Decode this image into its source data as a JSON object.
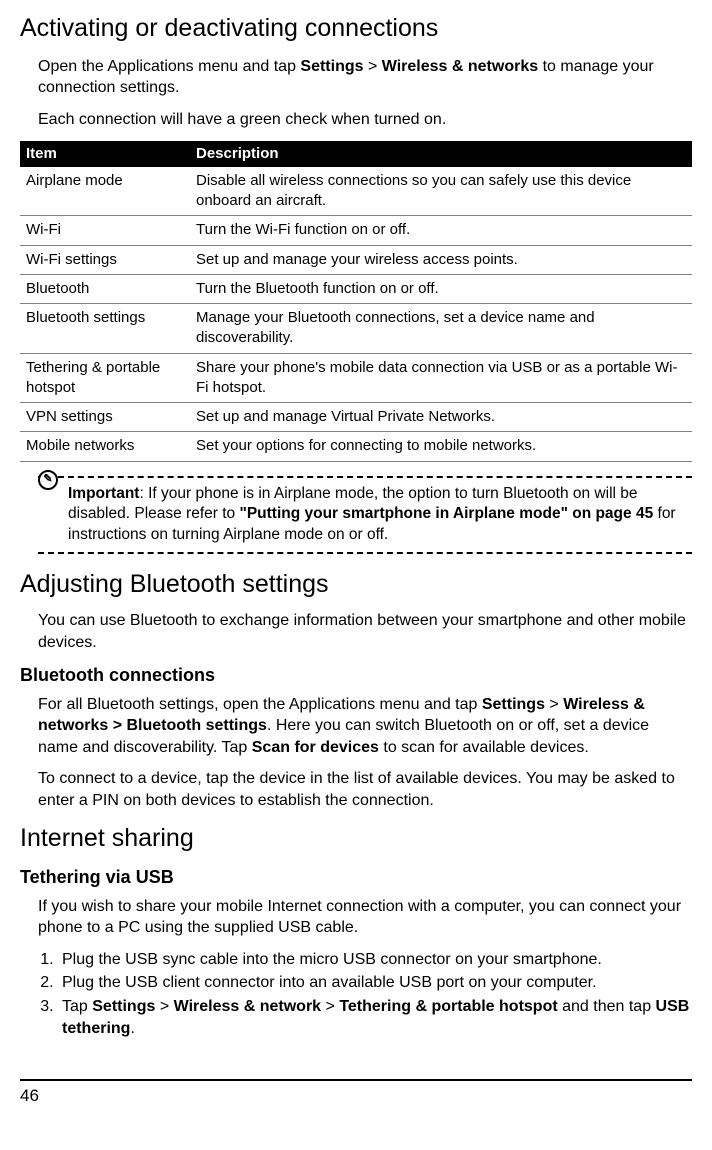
{
  "h1": "Activating or deactivating connections",
  "intro": {
    "p1_pre": "Open the Applications menu and tap ",
    "p1_b1": "Settings",
    "p1_mid": " > ",
    "p1_b2": "Wireless & networks",
    "p1_post": " to manage your connection settings.",
    "p2": "Each connection will have a green check when turned on."
  },
  "table": {
    "headers": {
      "c1": "Item",
      "c2": "Description"
    },
    "rows": [
      {
        "item": "Airplane mode",
        "desc": "Disable all wireless connections so you can safely use this device onboard an aircraft."
      },
      {
        "item": "Wi-Fi",
        "desc": "Turn the Wi-Fi function on or off."
      },
      {
        "item": "Wi-Fi settings",
        "desc": "Set up and manage your wireless access points."
      },
      {
        "item": "Bluetooth",
        "desc": "Turn the Bluetooth function on or off."
      },
      {
        "item": "Bluetooth settings",
        "desc": "Manage your Bluetooth connections, set a device name and discoverability."
      },
      {
        "item": "Tethering & portable hotspot",
        "desc": "Share your phone's mobile data connection via USB or as a portable Wi-Fi hotspot."
      },
      {
        "item": "VPN settings",
        "desc": "Set up and manage Virtual Private Networks."
      },
      {
        "item": "Mobile networks",
        "desc": "Set your options for connecting to mobile networks."
      }
    ]
  },
  "note": {
    "icon_glyph": "✎",
    "label": "Important",
    "pre": ": If your phone is in Airplane mode, the option to turn Bluetooth on will be disabled. Please refer to ",
    "link": "\"Putting your smartphone in Airplane mode\" on page 45",
    "post": " for instructions on turning Airplane mode on or off."
  },
  "h1b": "Adjusting Bluetooth settings",
  "adjust_p": "You can use Bluetooth to exchange information between your smartphone and other mobile devices.",
  "sub_bt": "Bluetooth connections",
  "bt_p1": {
    "pre": "For all Bluetooth settings, open the Applications menu and tap ",
    "b1": "Settings",
    "sep1": " > ",
    "b2": "Wireless & networks > Bluetooth settings",
    "mid": ". Here you can switch Bluetooth on or off, set a device name and discoverability. Tap ",
    "b3": "Scan for devices",
    "post": " to scan for available devices."
  },
  "bt_p2": "To connect to a device, tap the device in the list of available devices. You may be asked to enter a PIN on both devices to establish the connection.",
  "h1c": "Internet sharing",
  "sub_usb": "Tethering via USB",
  "usb_p": "If you wish to share your mobile Internet connection with a computer, you can connect your phone to a PC using the supplied USB cable.",
  "steps": {
    "s1": "Plug the USB sync cable into the micro USB connector on your smartphone.",
    "s2": "Plug the USB client connector into an available USB port on your computer.",
    "s3": {
      "pre": "Tap ",
      "b1": "Settings",
      "sep1": " > ",
      "b2": "Wireless & network",
      "sep2": " > ",
      "b3": "Tethering & portable hotspot",
      "mid": " and then tap ",
      "b4": "USB tethering",
      "post": "."
    }
  },
  "page_number": "46"
}
